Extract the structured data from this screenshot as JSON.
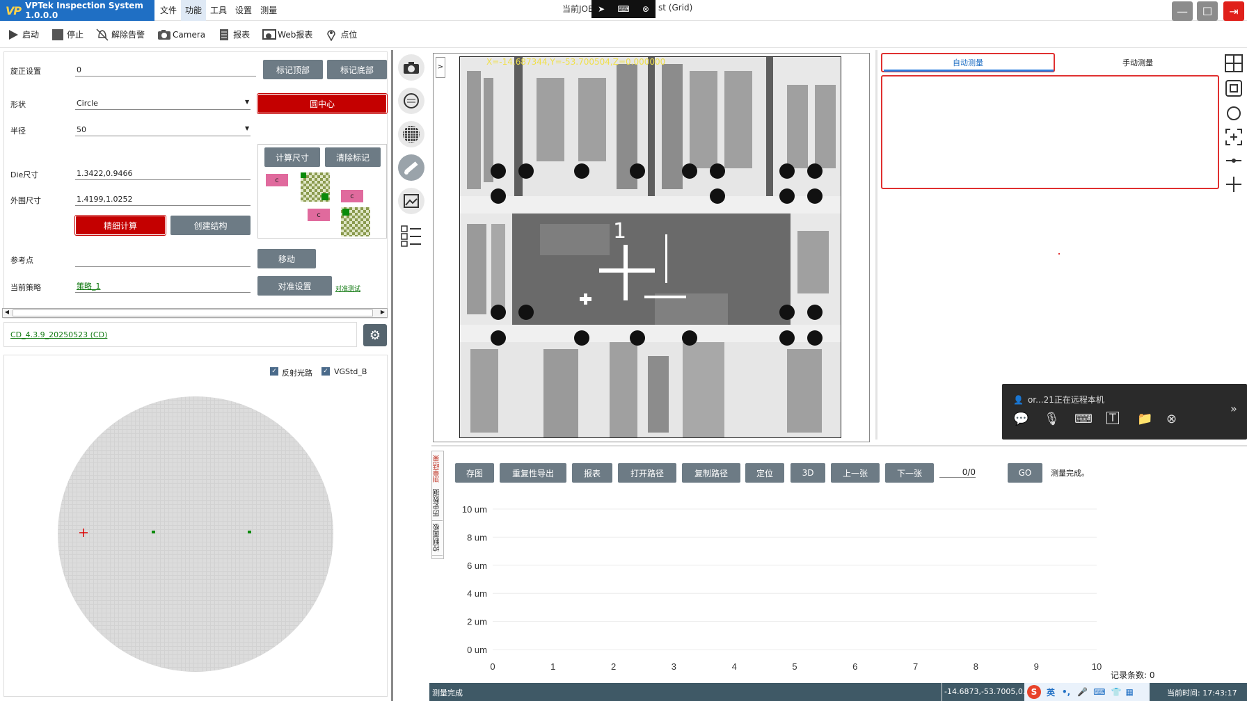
{
  "app": {
    "title": "VPTek Inspection System 1.0.0.0",
    "menu": [
      "文件",
      "功能",
      "工具",
      "设置",
      "测量"
    ],
    "active_menu": "功能",
    "job_label_left": "当前JOB",
    "job_label_right": "st (Grid)"
  },
  "toolbar": {
    "items": [
      {
        "label": "启动",
        "icon": "play-icon"
      },
      {
        "label": "停止",
        "icon": "stop-icon"
      },
      {
        "label": "解除告警",
        "icon": "alarm-off-icon"
      },
      {
        "label": "Camera",
        "icon": "camera-icon"
      },
      {
        "label": "报表",
        "icon": "report-icon"
      },
      {
        "label": "Web报表",
        "icon": "web-report-icon"
      },
      {
        "label": "点位",
        "icon": "location-pin-icon"
      }
    ]
  },
  "left": {
    "rotation_label": "旋正设置",
    "rotation_value": "0",
    "mark_top": "标记顶部",
    "mark_bottom": "标记底部",
    "shape_label": "形状",
    "shape_value": "Circle",
    "circle_center": "圆中心",
    "radius_label": "半径",
    "radius_value": "50",
    "calc_size": "计算尺寸",
    "clear_mark": "清除标记",
    "chip_label": "c",
    "die_label": "Die尺寸",
    "die_value": "1.3422,0.9466",
    "outer_label": "外围尺寸",
    "outer_value": "1.4199,1.0252",
    "fine_calc": "精细计算",
    "create_struct": "创建结构",
    "ref_label": "参考点",
    "ref_value": "",
    "move": "移动",
    "strategy_label": "当前策略",
    "strategy_value": "策略_1",
    "align_settings": "对准设置",
    "align_test": "对准测试",
    "recipe": "CD_4.3.9_20250523 (CD)",
    "chk_reflect": "反射光路",
    "chk_vg": "VGStd_B"
  },
  "image": {
    "coords": "X=-14.687344,Y=-53.700504,Z=0.000000"
  },
  "right": {
    "tab_auto": "自动测量",
    "tab_manual": "手动测量"
  },
  "chat": {
    "status": "or...21正在远程本机"
  },
  "bottom": {
    "side_tabs": [
      "测量结果",
      "历史数据",
      "控制面板"
    ],
    "buttons": [
      "存图",
      "重复性导出",
      "报表",
      "打开路径",
      "复制路径",
      "定位",
      "3D",
      "上一张",
      "下一张"
    ],
    "counter": "0/0",
    "go": "GO",
    "status": "测量完成。",
    "record_count": "记录条数: 0"
  },
  "chart_data": {
    "type": "line",
    "x_ticks": [
      "0",
      "1",
      "2",
      "3",
      "4",
      "5",
      "6",
      "7",
      "8",
      "9",
      "10"
    ],
    "y_ticks": [
      "10 um",
      "8 um",
      "6 um",
      "4 um",
      "2 um",
      "0 um"
    ],
    "xlim": [
      0,
      10
    ],
    "ylim": [
      0,
      10
    ],
    "series": [],
    "grid": true
  },
  "statusbar": {
    "left": "测量完成",
    "coords": "-14.6873,-53.7005,0.0",
    "ime": "英",
    "time": "当前时间: 17:43:17"
  }
}
